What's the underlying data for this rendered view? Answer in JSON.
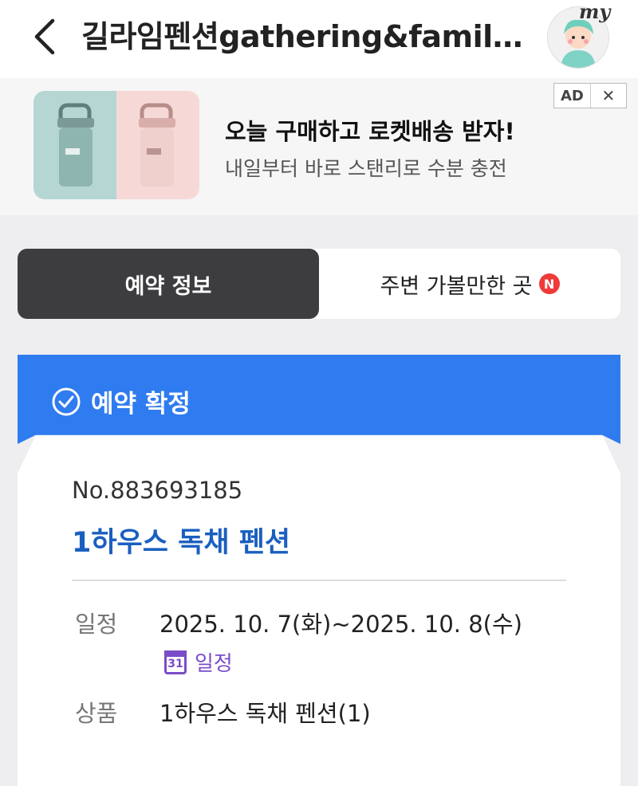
{
  "header": {
    "title": "길라임펜션gathering&family...",
    "avatar_label": "my"
  },
  "ad": {
    "title": "오늘 구매하고 로켓배송 받자!",
    "subtitle": "내일부터 바로 스탠리로 수분 충전",
    "badge": "AD",
    "close": "✕",
    "colors": {
      "left": "#b5d6d2",
      "right": "#f6d9d7"
    }
  },
  "tabs": [
    {
      "label": "예약 정보",
      "active": true
    },
    {
      "label": "주변 가볼만한 곳",
      "badge": "N",
      "active": false
    }
  ],
  "status": {
    "label": "예약 확정",
    "color": "#2f7bf0"
  },
  "reservation": {
    "number": "No.883693185",
    "name": "1하우스 독채 펜션",
    "schedule_label": "일정",
    "schedule_value": "2025. 10. 7(화)~2025. 10. 8(수)",
    "calendar_link": "일정",
    "calendar_day": "31",
    "product_label": "상품",
    "product_value": "1하우스 독채 펜션(1)"
  }
}
